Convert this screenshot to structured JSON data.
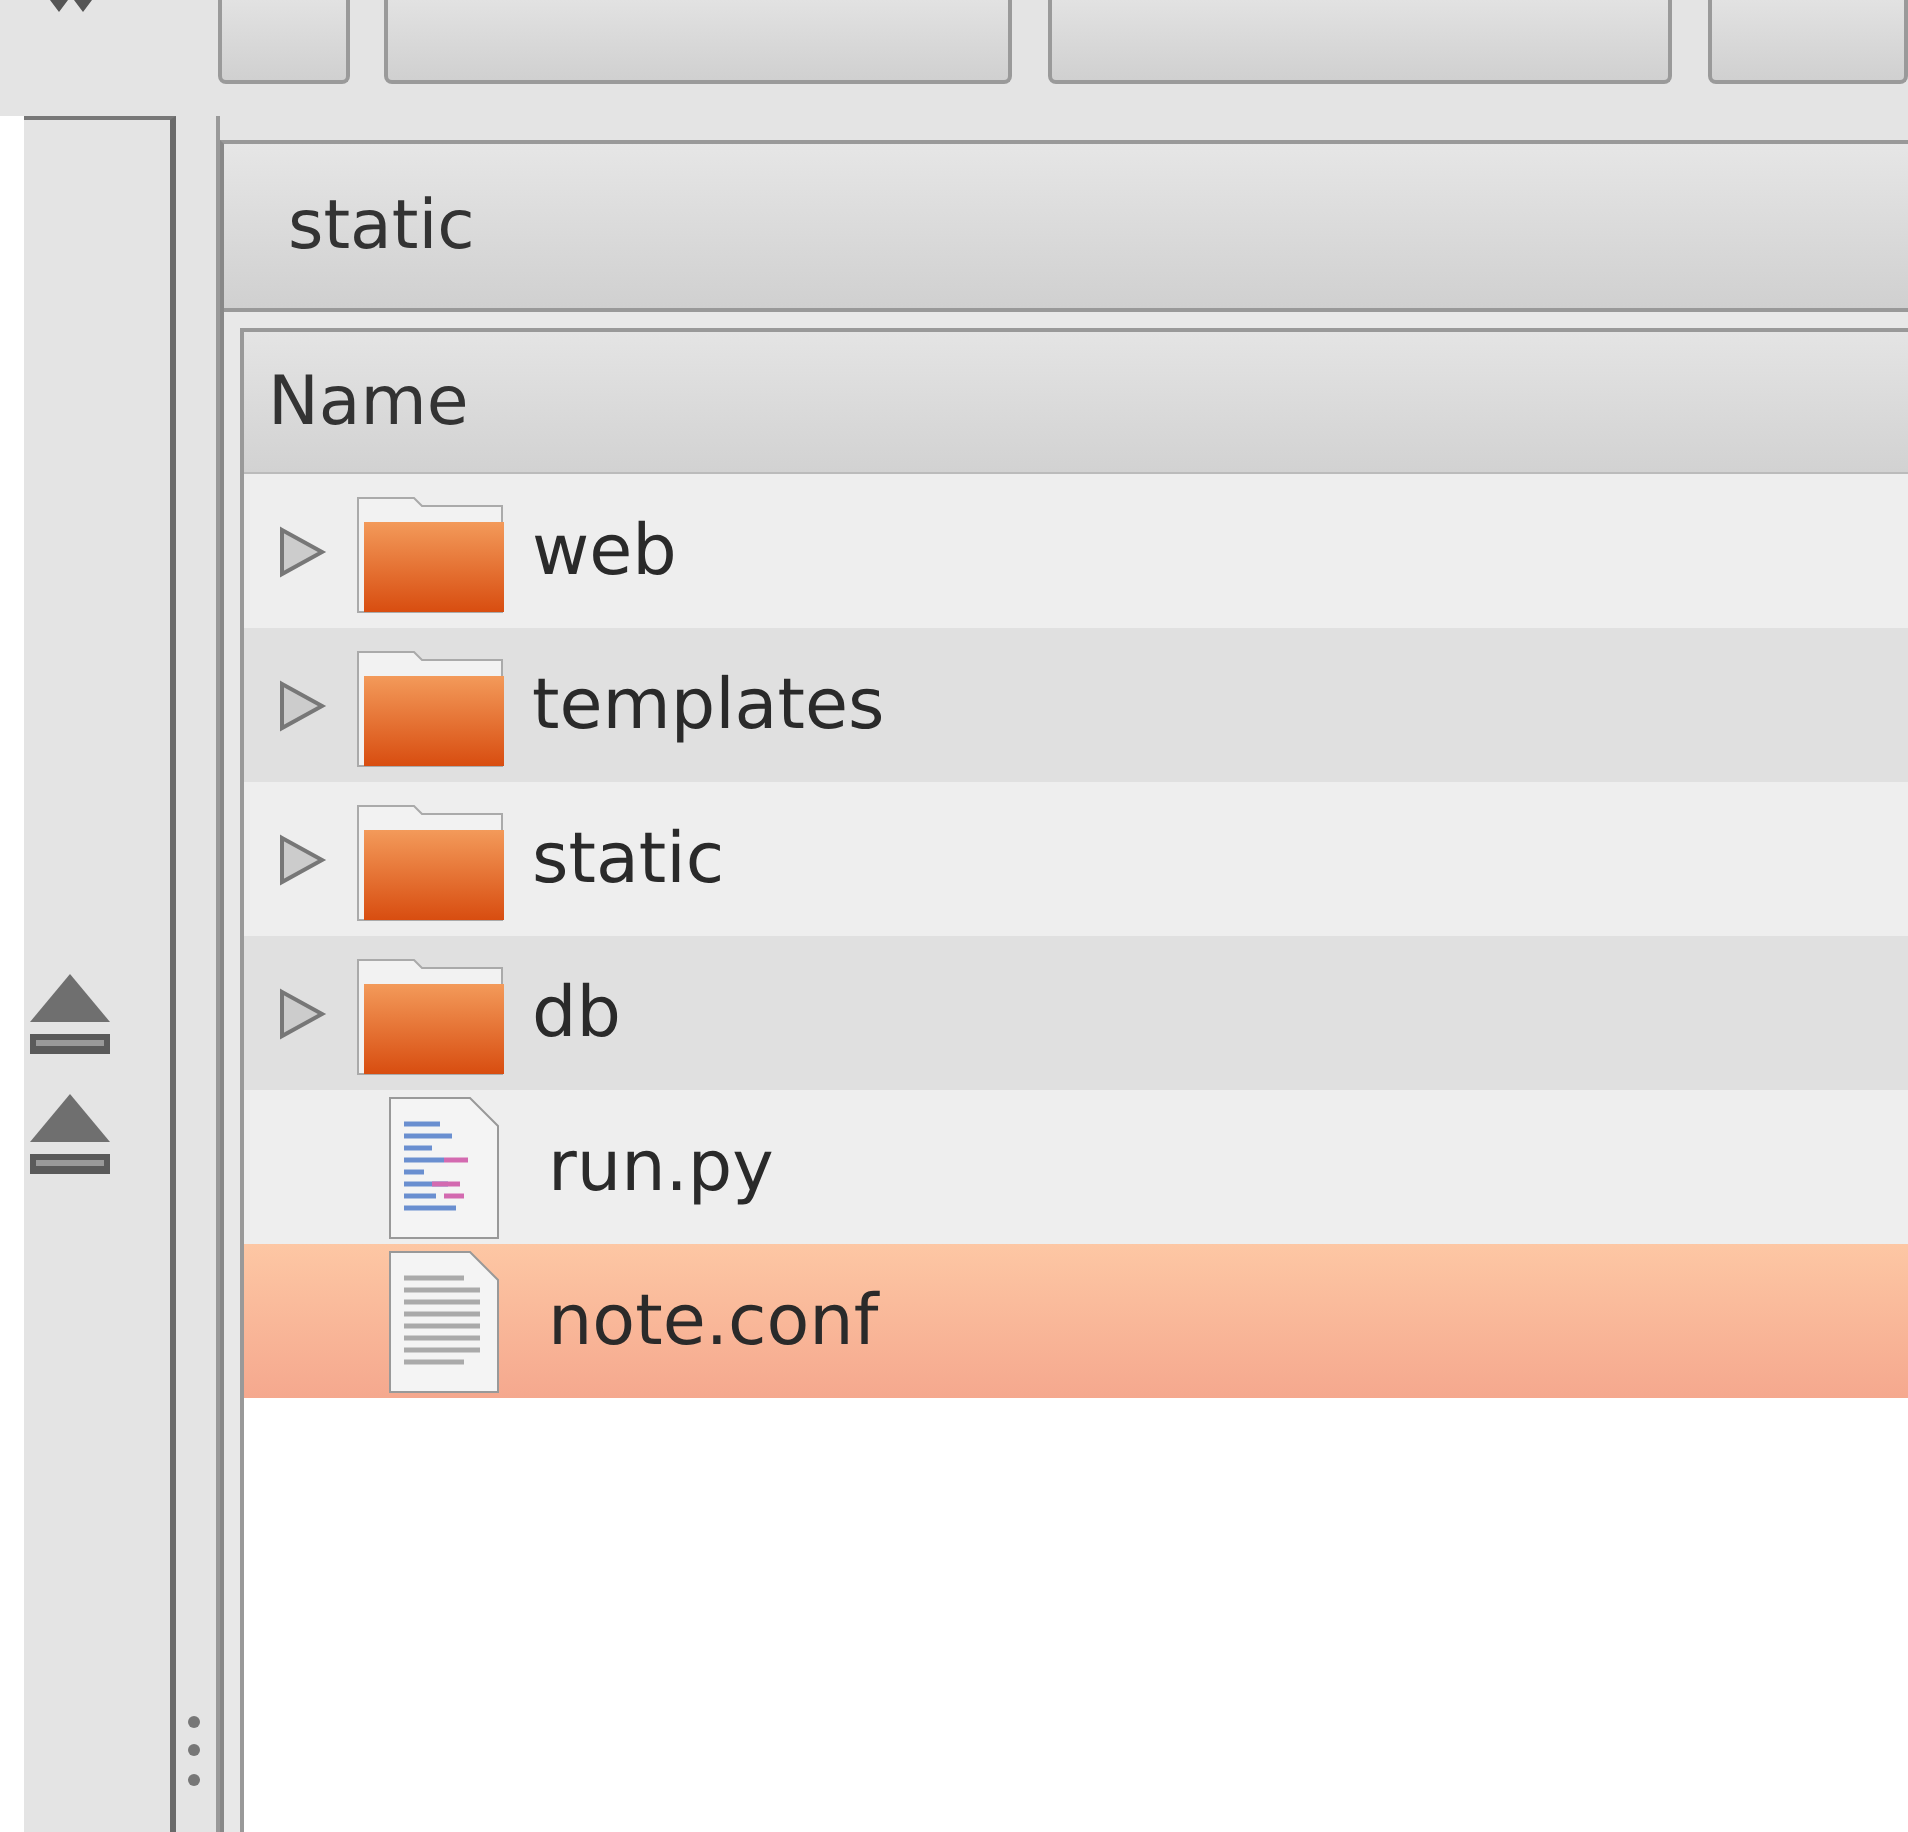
{
  "location": {
    "title": "static"
  },
  "list": {
    "columns": [
      "Name"
    ],
    "rows": [
      {
        "name": "web",
        "kind": "folder",
        "expanded": false,
        "selected": false
      },
      {
        "name": "templates",
        "kind": "folder",
        "expanded": false,
        "selected": false
      },
      {
        "name": "static",
        "kind": "folder",
        "expanded": false,
        "selected": false
      },
      {
        "name": "db",
        "kind": "folder",
        "expanded": false,
        "selected": false
      },
      {
        "name": "run.py",
        "kind": "code",
        "selected": false
      },
      {
        "name": "note.conf",
        "kind": "text",
        "selected": true
      }
    ]
  }
}
